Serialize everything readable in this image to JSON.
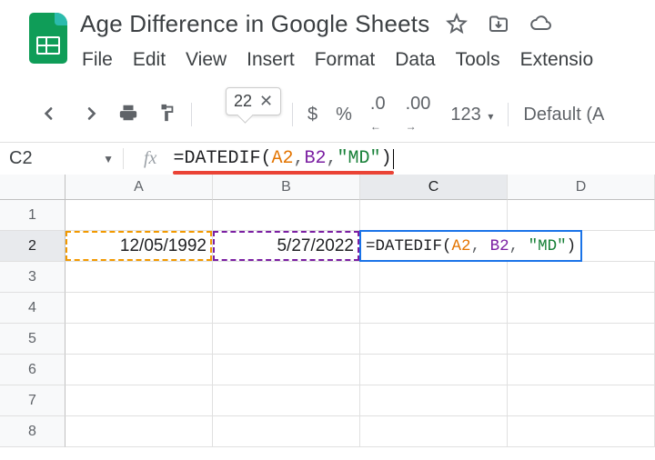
{
  "doc_title": "Age Difference in Google Sheets",
  "menubar": {
    "file": "File",
    "edit": "Edit",
    "view": "View",
    "insert": "Insert",
    "format": "Format",
    "data": "Data",
    "tools": "Tools",
    "extensions": "Extensio"
  },
  "toolbar": {
    "tooltip_value": "22",
    "currency": "$",
    "percent": "%",
    "dec_less": ".0",
    "dec_more": ".00",
    "numfmt": "123",
    "font": "Default (A"
  },
  "name_box": "C2",
  "formula": {
    "eq": "=",
    "fn": "DATEDIF",
    "lp": "(",
    "ref1": "A2",
    "comma": ", ",
    "ref2": "B2",
    "comma2": ", ",
    "str": "\"MD\"",
    "rp": ")"
  },
  "columns": [
    "A",
    "B",
    "C",
    "D"
  ],
  "rows": [
    "1",
    "2",
    "3",
    "4",
    "5",
    "6",
    "7",
    "8"
  ],
  "cells": {
    "A2": "12/05/1992",
    "B2": "5/27/2022"
  }
}
